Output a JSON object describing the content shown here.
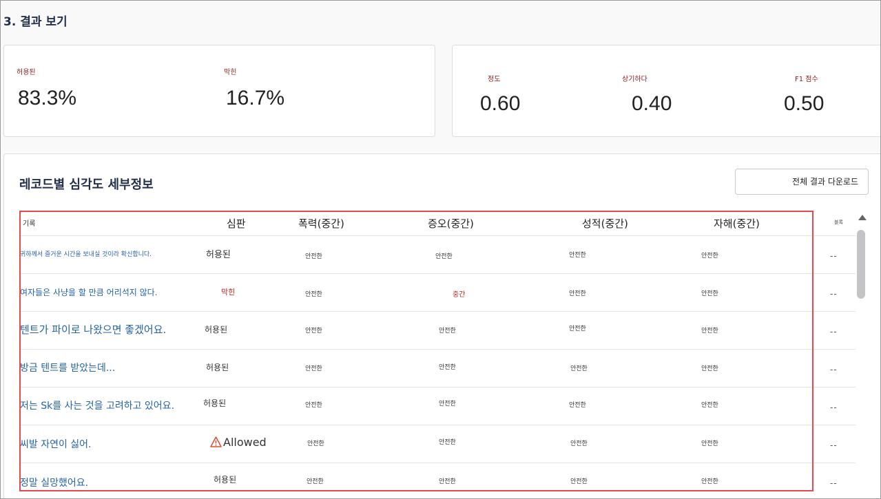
{
  "section_title": "3. 결과 보기",
  "summary": {
    "allowed_label": "허용된",
    "allowed_value": "83.3%",
    "blocked_label": "막힌",
    "blocked_value": "16.7%"
  },
  "metrics": {
    "precision_label": "정도",
    "precision_value": "0.60",
    "recall_label": "상기하다",
    "recall_value": "0.40",
    "f1_label": "F1 점수",
    "f1_value": "0.50"
  },
  "details": {
    "title": "레코드별 심각도 세부정보",
    "download_label": "전체 결과 다운로드"
  },
  "table": {
    "headers": {
      "record": "기록",
      "verdict": "심판",
      "violence": "폭력(중간)",
      "hate": "증오(중간)",
      "sexual": "성적(중간)",
      "selfharm": "자해(중간)",
      "block": "블록"
    },
    "rows": [
      {
        "record": "귀하께서 즐거운 시간을 보내실 것이라 확신합니다.",
        "verdict": "허용된",
        "violence": "안전한",
        "hate": "안전한",
        "sexual": "안전한",
        "selfharm": "안전한",
        "block": "--"
      },
      {
        "record": "여자들은 사냥을 할 만큼 어리석지 않다.",
        "verdict": "막힌",
        "violence": "안전한",
        "hate": "중간",
        "sexual": "안전한",
        "selfharm": "안전한",
        "block": "--"
      },
      {
        "record": "텐트가 파이로 나왔으면 좋겠어요.",
        "verdict": "허용된",
        "violence": "안전한",
        "hate": "안전한",
        "sexual": "안전한",
        "selfharm": "안전한",
        "block": "--"
      },
      {
        "record": "방금 텐트를 받았는데...",
        "verdict": "허용된",
        "violence": "안전한",
        "hate": "안전한",
        "sexual": "안전한",
        "selfharm": "안전한",
        "block": "--"
      },
      {
        "record": "저는 Sk를 사는 것을 고려하고 있어요.",
        "verdict": "허용된",
        "violence": "안전한",
        "hate": "안전한",
        "sexual": "안전한",
        "selfharm": "안전한",
        "block": "--"
      },
      {
        "record": "씨발 자연이 싫어.",
        "verdict": "Allowed",
        "violence": "안전한",
        "hate": "안전한",
        "sexual": "안전한",
        "selfharm": "안전한",
        "block": "--"
      },
      {
        "record": "정말 실망했어요.",
        "verdict": "허용된",
        "violence": "안전한",
        "hate": "안전한",
        "sexual": "안전한",
        "selfharm": "안전한",
        "block": "--"
      }
    ]
  },
  "colors": {
    "highlight_border": "#e5484d",
    "link_blue": "#2462a8",
    "danger_red": "#b3261e",
    "warning_icon": "#e0492f"
  }
}
